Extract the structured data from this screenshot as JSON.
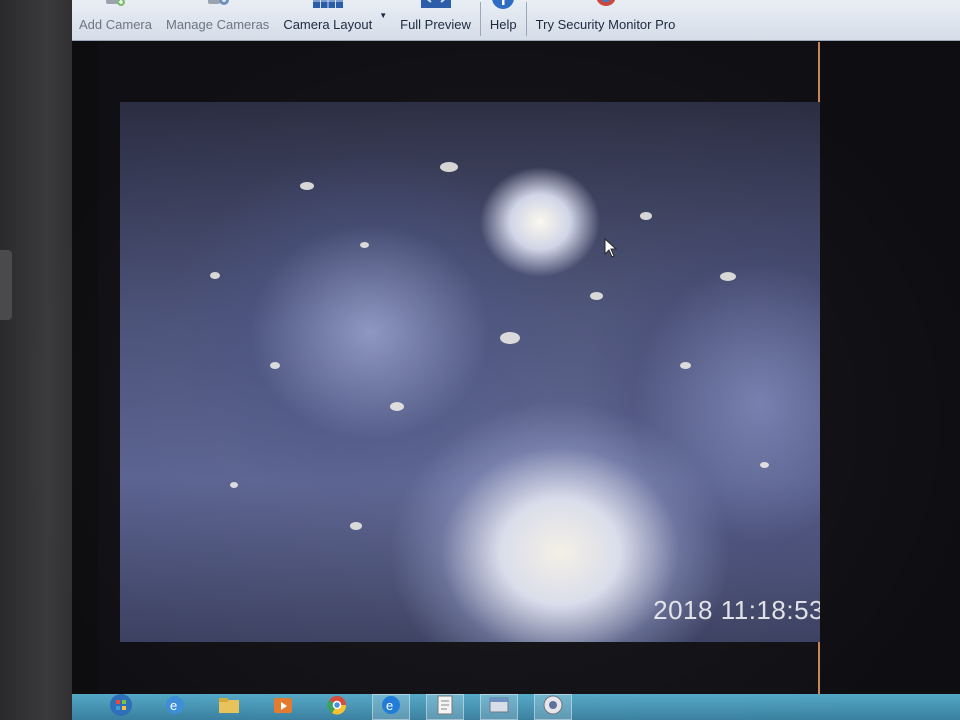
{
  "toolbar": {
    "items": [
      {
        "label": "Add Camera",
        "icon": "add-camera-icon",
        "enabled": false
      },
      {
        "label": "Manage Cameras",
        "icon": "manage-cameras-icon",
        "enabled": false
      },
      {
        "label": "Camera Layout",
        "icon": "camera-layout-icon",
        "enabled": true,
        "has_dropdown": true
      },
      {
        "label": "Full Preview",
        "icon": "full-preview-icon",
        "enabled": true
      },
      {
        "label": "Help",
        "icon": "help-icon",
        "enabled": true
      },
      {
        "label": "Try Security Monitor Pro",
        "icon": "security-monitor-pro-icon",
        "enabled": true
      }
    ]
  },
  "camera": {
    "timestamp": "11:18:53",
    "date_fragment": "2018"
  },
  "taskbar": {
    "items": [
      {
        "icon": "start-button-icon"
      },
      {
        "icon": "internet-explorer-icon"
      },
      {
        "icon": "file-explorer-icon"
      },
      {
        "icon": "media-player-icon"
      },
      {
        "icon": "chrome-icon"
      },
      {
        "icon": "edge-browser-icon"
      },
      {
        "icon": "document-icon"
      },
      {
        "icon": "app-window-icon"
      },
      {
        "icon": "security-monitor-taskbar-icon"
      }
    ]
  },
  "colors": {
    "toolbar_bg": "#dde4ee",
    "taskbar_bg": "#4a97b6",
    "timestamp_text": "#f2f2f2",
    "viewport_border": "#c7855a"
  }
}
